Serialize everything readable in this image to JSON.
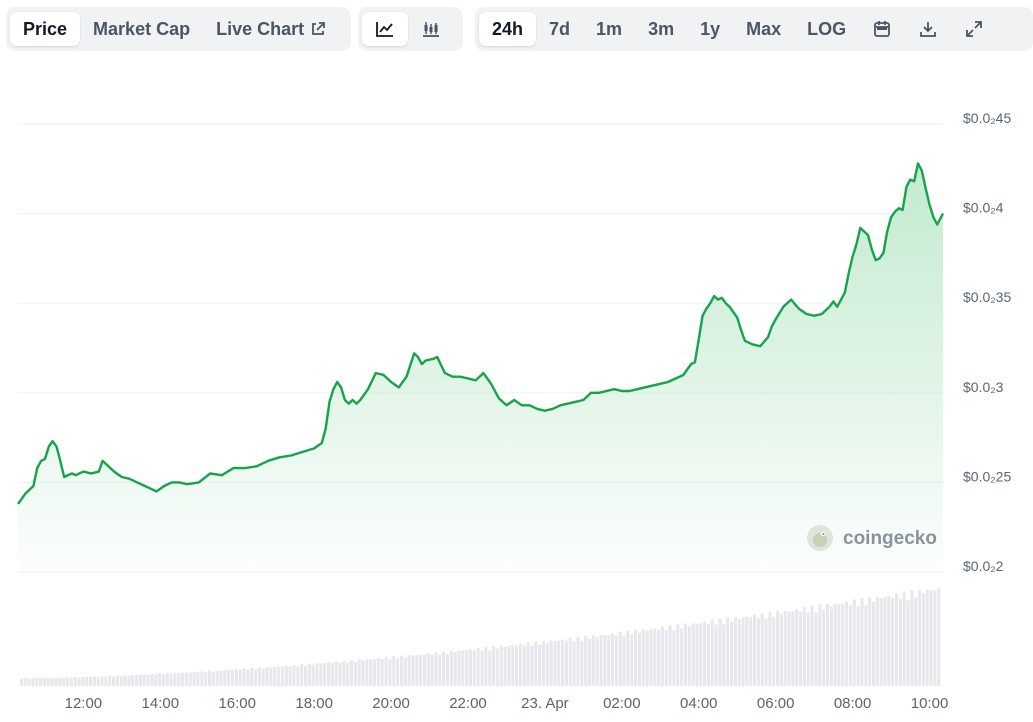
{
  "toolbar": {
    "metric_tabs": [
      "Price",
      "Market Cap",
      "Live Chart"
    ],
    "active_metric": "Price",
    "range_tabs": [
      "24h",
      "7d",
      "1m",
      "3m",
      "1y",
      "Max",
      "LOG"
    ],
    "active_range": "24h"
  },
  "icons": {
    "external": "external-link-icon",
    "line_chart": "line-chart-icon",
    "candlestick": "candlestick-icon",
    "calendar": "calendar-icon",
    "download": "download-icon",
    "expand": "expand-icon"
  },
  "watermark": {
    "text": "coingecko"
  },
  "colors": {
    "line": "#16a34a",
    "fill_top": "#bfe9cc",
    "volume": "#e6e8eb",
    "grid": "#eef0f2"
  },
  "chart_data": {
    "type": "area",
    "y_ticks": [
      {
        "value": 0.0245,
        "label": "$0.0₂45"
      },
      {
        "value": 0.024,
        "label": "$0.0₂4"
      },
      {
        "value": 0.0235,
        "label": "$0.0₂35"
      },
      {
        "value": 0.023,
        "label": "$0.0₂3"
      },
      {
        "value": 0.0225,
        "label": "$0.0₂25"
      },
      {
        "value": 0.022,
        "label": "$0.0₂2"
      }
    ],
    "ylim": [
      0.022,
      0.0245
    ],
    "x_ticks": [
      {
        "value": 12,
        "label": "12:00"
      },
      {
        "value": 14,
        "label": "14:00"
      },
      {
        "value": 16,
        "label": "16:00"
      },
      {
        "value": 18,
        "label": "18:00"
      },
      {
        "value": 20,
        "label": "20:00"
      },
      {
        "value": 22,
        "label": "22:00"
      },
      {
        "value": 24,
        "label": "23. Apr"
      },
      {
        "value": 26,
        "label": "02:00"
      },
      {
        "value": 28,
        "label": "04:00"
      },
      {
        "value": 30,
        "label": "06:00"
      },
      {
        "value": 32,
        "label": "08:00"
      },
      {
        "value": 34,
        "label": "10:00"
      }
    ],
    "xlim": [
      10.3,
      34.35
    ],
    "grid": true,
    "legend": "none",
    "price": {
      "x": [
        10.3,
        10.5,
        10.7,
        10.8,
        10.9,
        11.0,
        11.1,
        11.2,
        11.3,
        11.4,
        11.5,
        11.7,
        11.8,
        12.0,
        12.2,
        12.4,
        12.5,
        12.6,
        12.8,
        13.0,
        13.2,
        13.4,
        13.6,
        13.8,
        13.9,
        14.1,
        14.3,
        14.5,
        14.7,
        15.0,
        15.3,
        15.6,
        15.9,
        16.2,
        16.5,
        16.8,
        17.1,
        17.4,
        17.7,
        18.0,
        18.2,
        18.3,
        18.4,
        18.5,
        18.6,
        18.7,
        18.8,
        18.9,
        19.0,
        19.1,
        19.2,
        19.4,
        19.6,
        19.8,
        20.0,
        20.2,
        20.4,
        20.6,
        20.7,
        20.8,
        20.9,
        21.1,
        21.2,
        21.4,
        21.6,
        21.8,
        22.0,
        22.2,
        22.4,
        22.6,
        22.8,
        23.0,
        23.2,
        23.4,
        23.6,
        23.8,
        24.0,
        24.2,
        24.4,
        24.6,
        24.8,
        25.0,
        25.2,
        25.4,
        25.6,
        25.8,
        26.0,
        26.2,
        26.4,
        26.6,
        26.8,
        27.0,
        27.2,
        27.4,
        27.6,
        27.7,
        27.8,
        27.9,
        28.0,
        28.1,
        28.2,
        28.3,
        28.4,
        28.5,
        28.6,
        28.7,
        28.8,
        28.9,
        29.0,
        29.1,
        29.2,
        29.4,
        29.6,
        29.8,
        29.9,
        30.0,
        30.2,
        30.4,
        30.6,
        30.8,
        31.0,
        31.2,
        31.4,
        31.5,
        31.6,
        31.7,
        31.8,
        31.9,
        32.0,
        32.1,
        32.2,
        32.4,
        32.5,
        32.6,
        32.7,
        32.8,
        32.9,
        33.0,
        33.1,
        33.2,
        33.3,
        33.4,
        33.5,
        33.6,
        33.7,
        33.8,
        33.9,
        34.0,
        34.1,
        34.2,
        34.35
      ],
      "y": [
        0.02238,
        0.02244,
        0.02248,
        0.02258,
        0.02262,
        0.02263,
        0.0227,
        0.02273,
        0.0227,
        0.02262,
        0.02253,
        0.02255,
        0.02254,
        0.02256,
        0.02255,
        0.02256,
        0.02262,
        0.0226,
        0.02256,
        0.02253,
        0.02252,
        0.0225,
        0.02248,
        0.02246,
        0.02245,
        0.02248,
        0.0225,
        0.0225,
        0.02249,
        0.0225,
        0.02255,
        0.02254,
        0.02258,
        0.02258,
        0.02259,
        0.02262,
        0.02264,
        0.02265,
        0.02267,
        0.02269,
        0.02272,
        0.0228,
        0.02295,
        0.02302,
        0.02306,
        0.02303,
        0.02296,
        0.02294,
        0.02296,
        0.02294,
        0.02296,
        0.02302,
        0.02311,
        0.0231,
        0.02306,
        0.02303,
        0.02309,
        0.02322,
        0.0232,
        0.02316,
        0.02318,
        0.02319,
        0.0232,
        0.02311,
        0.02309,
        0.02309,
        0.02308,
        0.02307,
        0.02311,
        0.02305,
        0.02297,
        0.02293,
        0.02296,
        0.02293,
        0.02293,
        0.02291,
        0.0229,
        0.02291,
        0.02293,
        0.02294,
        0.02295,
        0.02296,
        0.023,
        0.023,
        0.02301,
        0.02302,
        0.02301,
        0.02301,
        0.02302,
        0.02303,
        0.02304,
        0.02305,
        0.02306,
        0.02308,
        0.0231,
        0.02313,
        0.02316,
        0.02317,
        0.0233,
        0.02343,
        0.02347,
        0.0235,
        0.02354,
        0.02352,
        0.02353,
        0.0235,
        0.02348,
        0.02345,
        0.02342,
        0.02335,
        0.02329,
        0.02327,
        0.02326,
        0.02331,
        0.02337,
        0.02341,
        0.02348,
        0.02352,
        0.02347,
        0.02344,
        0.02343,
        0.02344,
        0.02348,
        0.02351,
        0.02348,
        0.02352,
        0.02356,
        0.02367,
        0.02376,
        0.02383,
        0.02392,
        0.02388,
        0.0238,
        0.02374,
        0.02375,
        0.02378,
        0.0239,
        0.02398,
        0.02401,
        0.02403,
        0.02402,
        0.02415,
        0.02419,
        0.02418,
        0.02428,
        0.02424,
        0.02414,
        0.02405,
        0.02398,
        0.02394,
        0.024,
        0.02412,
        0.02409,
        0.02405,
        0.02402
      ]
    },
    "volume": {
      "x_start": 10.35,
      "x_end": 34.3,
      "count": 240,
      "relative_start": 0.08,
      "relative_end": 1.0
    }
  }
}
